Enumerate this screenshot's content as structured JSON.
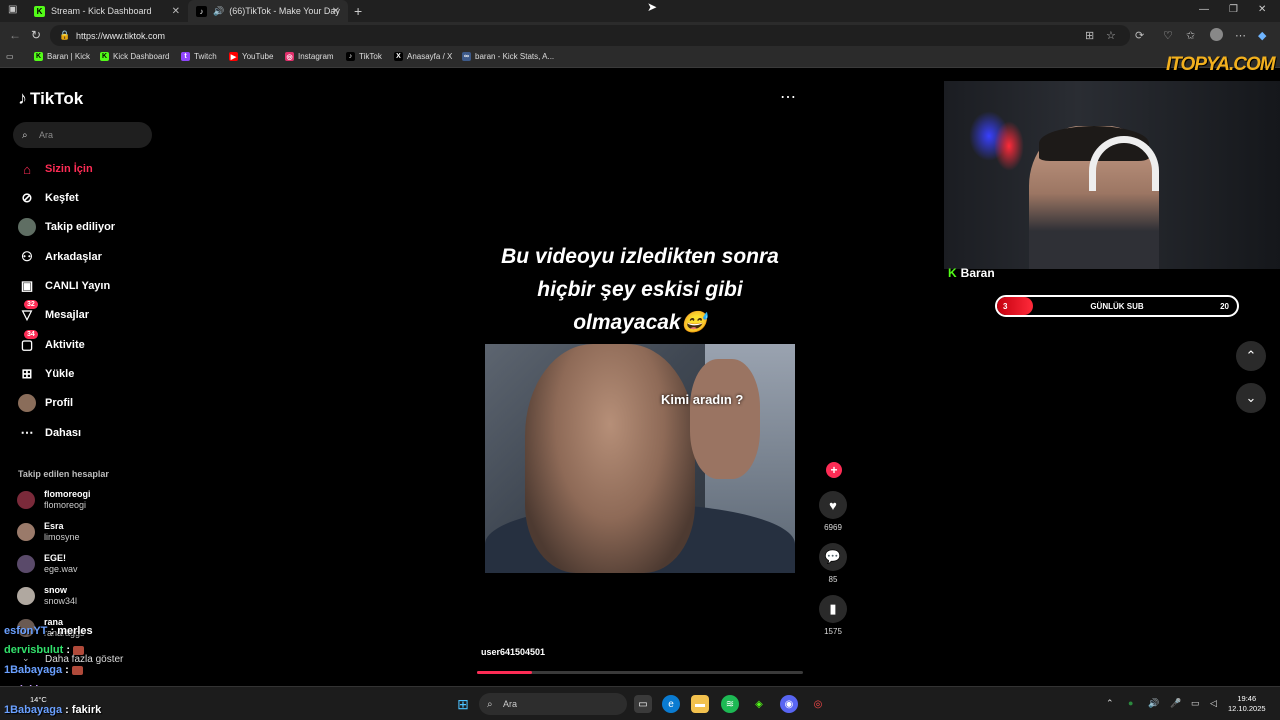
{
  "browser": {
    "tabs": [
      {
        "title": "Stream - Kick Dashboard",
        "favicon": "kick-icon",
        "active": false
      },
      {
        "title": "(66)TikTok - Make Your Day",
        "favicon": "tiktok-icon",
        "active": true
      }
    ],
    "url": "https://www.tiktok.com",
    "bookmarks": [
      {
        "label": "Baran | Kick",
        "icon": "kick-icon",
        "color": "#53fc18"
      },
      {
        "label": "Kick Dashboard",
        "icon": "kick-icon",
        "color": "#53fc18"
      },
      {
        "label": "Twitch",
        "icon": "twitch-icon",
        "color": "#9146ff"
      },
      {
        "label": "YouTube",
        "icon": "youtube-icon",
        "color": "#ff0000"
      },
      {
        "label": "Instagram",
        "icon": "instagram-icon",
        "color": "#e1306c"
      },
      {
        "label": "TikTok",
        "icon": "tiktok-icon",
        "color": "#ffffff"
      },
      {
        "label": "Anasayfa / X",
        "icon": "x-icon",
        "color": "#ffffff"
      },
      {
        "label": "baran - Kick Stats, A...",
        "icon": "stats-icon",
        "color": "#8ab4f8"
      }
    ]
  },
  "tiktok": {
    "logo": "TikTok",
    "search_placeholder": "Ara",
    "menu": [
      {
        "label": "Sizin İçin",
        "icon": "home-icon",
        "active": true
      },
      {
        "label": "Keşfet",
        "icon": "compass-icon"
      },
      {
        "label": "Takip ediliyor",
        "icon": "avatar-icon"
      },
      {
        "label": "Arkadaşlar",
        "icon": "friends-icon"
      },
      {
        "label": "CANLI Yayın",
        "icon": "live-tv-icon"
      },
      {
        "label": "Mesajlar",
        "icon": "message-icon",
        "badge": "32"
      },
      {
        "label": "Aktivite",
        "icon": "activity-icon",
        "badge": "34"
      },
      {
        "label": "Yükle",
        "icon": "upload-icon"
      },
      {
        "label": "Profil",
        "icon": "avatar-icon"
      },
      {
        "label": "Dahası",
        "icon": "more-dots-icon"
      }
    ],
    "following_header": "Takip edilen hesaplar",
    "following": [
      {
        "name": "flomoreogi",
        "handle": "flomoreogi"
      },
      {
        "name": "Esra",
        "handle": "limosyne"
      },
      {
        "name": "EGE!",
        "handle": "ege.wav"
      },
      {
        "name": "snow",
        "handle": "snow34l"
      },
      {
        "name": "rana",
        "handle": "ranaraggs"
      }
    ],
    "see_more": "Daha fazla göster",
    "video": {
      "caption": "Bu videoyu izledikten sonra hiçbir şey eskisi gibi olmayacak😅",
      "overlay_text": "Kimi aradın ?",
      "username": "user641504501",
      "likes": "6969",
      "comments": "85",
      "saves": "1575",
      "progress": 0.17
    }
  },
  "stream_overlay": {
    "watermark": "ITOPYA.COM",
    "streamer": "Baran",
    "sub_goal": {
      "current": "3",
      "label": "GÜNLÜK SUB",
      "goal": "20",
      "progress": 0.15
    },
    "chat": [
      {
        "user": "esfonYT",
        "message": "merles",
        "color": "#6aa0ff"
      },
      {
        "user": "dervisbulut",
        "message": "",
        "color": "#32e06b",
        "emote": true
      },
      {
        "user": "1Babayaga",
        "message": "",
        "color": "#6aa0ff",
        "emote": true
      },
      {
        "user": "melekbossanova",
        "message": "",
        "color": "#c79bff",
        "emote": true
      },
      {
        "user": "1Babayaga",
        "message": "fakirk",
        "color": "#6aa0ff"
      }
    ]
  },
  "taskbar": {
    "search_placeholder": "Ara",
    "weather": "14°C",
    "time": "19:46",
    "date": "12.10.2025"
  }
}
